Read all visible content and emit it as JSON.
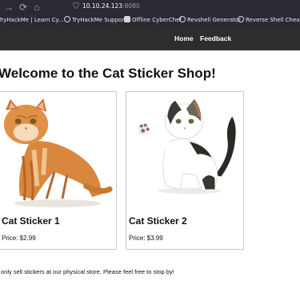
{
  "browser": {
    "url_host": "10.10.24.123",
    "url_port": ":8080",
    "bookmarks": [
      "TryHackMe | Learn Cy...",
      "TryHackMe Support",
      "Offline CyberChef",
      "Revshell Generator",
      "Reverse Shell Cheat S..."
    ]
  },
  "site_nav": {
    "home": "Home",
    "feedback": "Feedback"
  },
  "page": {
    "title": "Welcome to the Cat Sticker Shop!",
    "footer_note": "only sell stickers at our physical store. Please feel free to stop by!"
  },
  "products": [
    {
      "name": "Cat Sticker 1",
      "price": "Price: $2.99"
    },
    {
      "name": "Cat Sticker 2",
      "price": "Price: $3.99"
    }
  ]
}
